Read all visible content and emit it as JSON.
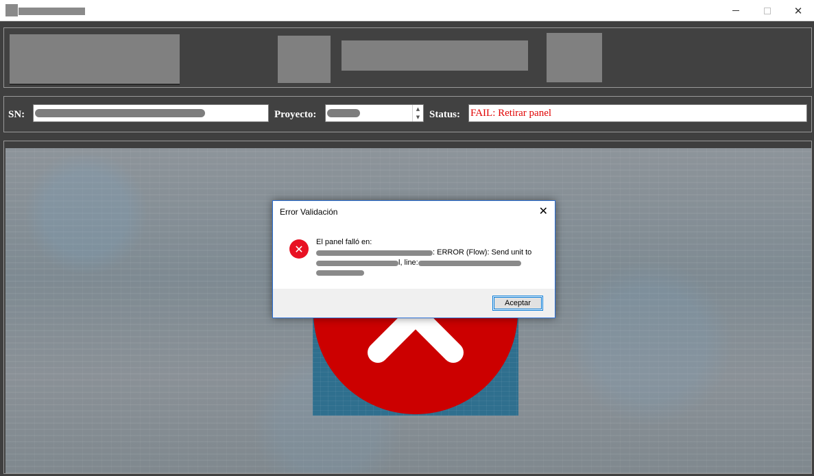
{
  "window": {
    "controls": {
      "minimize_icon": "minimize-icon",
      "maximize_icon": "maximize-icon",
      "close_icon": "close-icon"
    }
  },
  "form": {
    "sn_label": "SN:",
    "project_label": "Proyecto:",
    "status_label": "Status:",
    "status_value": "FAIL: Retirar panel",
    "status_color": "#e00000",
    "spin_up": "▲",
    "spin_down": "▼"
  },
  "result_image": {
    "icon": "fail-x-icon",
    "color": "#cc0000"
  },
  "dialog": {
    "title": "Error Validación",
    "close_glyph": "✕",
    "icon": "error-icon",
    "icon_glyph": "✕",
    "message_line1": "El panel falló en:",
    "message_line2_visible": ": ERROR (Flow): Send unit to",
    "message_line3_visible": "l, line:",
    "ok_button": "Aceptar"
  }
}
